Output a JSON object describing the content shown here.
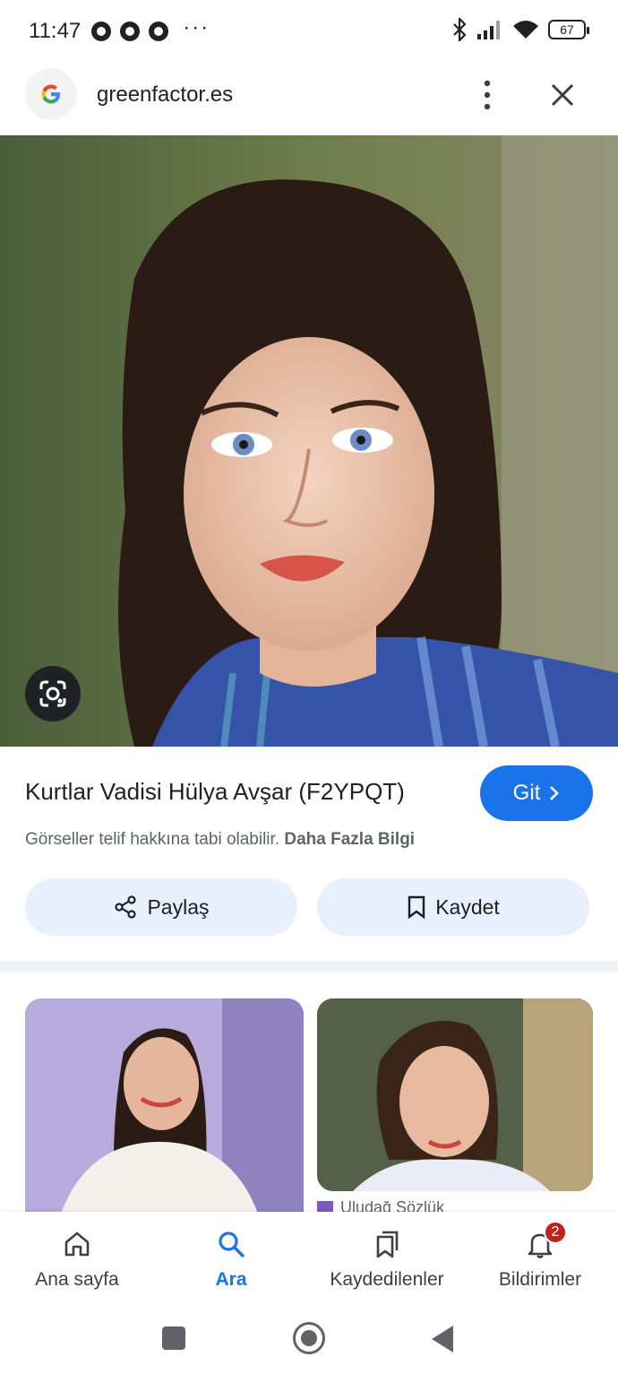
{
  "status_bar": {
    "time": "11:47",
    "more": "···",
    "battery": "67"
  },
  "header": {
    "site": "greenfactor.es",
    "icons": [
      "google-g-icon",
      "more-vert-icon",
      "close-icon"
    ]
  },
  "result": {
    "title": "Kurtlar Vadisi Hülya Avşar (F2YPQT)",
    "go_label": "Git",
    "copyright_text": "Görseller telif hakkına tabi olabilir.",
    "more_info_label": "Daha Fazla Bilgi",
    "share_label": "Paylaş",
    "save_label": "Kaydet"
  },
  "related": {
    "source_label": "Uludağ Sözlük"
  },
  "bottom_nav": {
    "items": [
      {
        "label": "Ana sayfa",
        "icon": "home-icon"
      },
      {
        "label": "Ara",
        "icon": "search-icon",
        "active": true
      },
      {
        "label": "Kaydedilenler",
        "icon": "bookmarks-icon"
      },
      {
        "label": "Bildirimler",
        "icon": "bell-icon",
        "badge": "2"
      }
    ]
  },
  "colors": {
    "accent": "#1a73e8",
    "chip_bg": "#e8f0fe",
    "badge": "#c5221f"
  }
}
